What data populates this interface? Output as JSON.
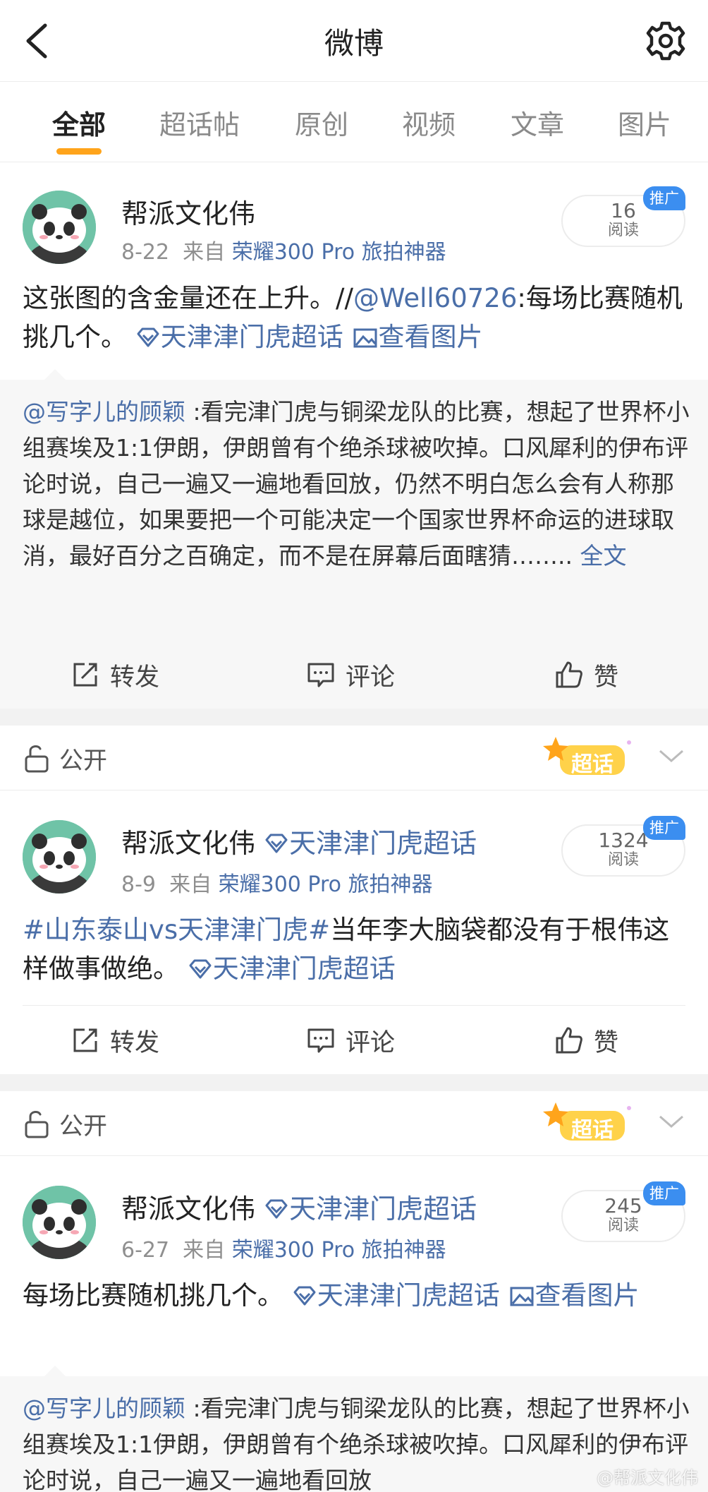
{
  "header": {
    "title": "微博",
    "icons": [
      "back-arrow-icon",
      "gear-icon"
    ]
  },
  "tabs": [
    {
      "label": "全部",
      "active": true
    },
    {
      "label": "超话帖",
      "active": false
    },
    {
      "label": "原创",
      "active": false
    },
    {
      "label": "视频",
      "active": false
    },
    {
      "label": "文章",
      "active": false
    },
    {
      "label": "图片",
      "active": false
    }
  ],
  "colors": {
    "accent": "#ffa41b",
    "link": "#4a6ea8",
    "promo": "#3b8ef0",
    "quote_bg": "#f7f7f7"
  },
  "posts": [
    {
      "username": "帮派文化伟",
      "topic_tag": "",
      "date": "8-22",
      "from_label": "来自",
      "source": "荣耀300 Pro 旅拍神器",
      "reads": "16",
      "reads_label": "阅读",
      "promo_badge": "推广",
      "text_plain1": "这张图的含金量还在上升。//",
      "mention": "@Well60726",
      "text_plain2": ":每场比赛随机挑几个。",
      "topic_link": "天津津门虎超话",
      "image_link": "查看图片",
      "quote": {
        "author": "@写字儿的顾颖",
        "text": " :看完津门虎与铜梁龙队的比赛，想起了世界杯小组赛埃及1:1伊朗，伊朗曾有个绝杀球被吹掉。口风犀利的伊布评论时说，自己一遍又一遍地看回放，仍然不明白怎么会有人称那球是越位，如果要把一个可能决定一个国家世界杯命运的进球取消，最好百分之百确定，而不是在屏幕后面瞎猜……..",
        "more": "全文"
      },
      "actions": {
        "repost": "转发",
        "comment": "评论",
        "like": "赞"
      }
    },
    {
      "visibility": "公开",
      "supertopic_badge": "超话",
      "username": "帮派文化伟",
      "topic_tag": "天津津门虎超话",
      "date": "8-9",
      "from_label": "来自",
      "source": "荣耀300 Pro 旅拍神器",
      "reads": "1324",
      "reads_label": "阅读",
      "promo_badge": "推广",
      "hashtag": "#山东泰山vs天津津门虎#",
      "text_plain": "当年李大脑袋都没有于根伟这样做事做绝。",
      "topic_link": "天津津门虎超话",
      "actions": {
        "repost": "转发",
        "comment": "评论",
        "like": "赞"
      }
    },
    {
      "visibility": "公开",
      "supertopic_badge": "超话",
      "username": "帮派文化伟",
      "topic_tag": "天津津门虎超话",
      "date": "6-27",
      "from_label": "来自",
      "source": "荣耀300 Pro 旅拍神器",
      "reads": "245",
      "reads_label": "阅读",
      "promo_badge": "推广",
      "text_plain": "每场比赛随机挑几个。",
      "topic_link": "天津津门虎超话",
      "image_link": "查看图片",
      "quote": {
        "author": "@写字儿的顾颖",
        "text": " :看完津门虎与铜梁龙队的比赛，想起了世界杯小组赛埃及1:1伊朗，伊朗曾有个绝杀球被吹掉。口风犀利的伊布评论时说，自己一遍又一遍地看回放"
      }
    }
  ],
  "watermark": "@帮派文化伟"
}
